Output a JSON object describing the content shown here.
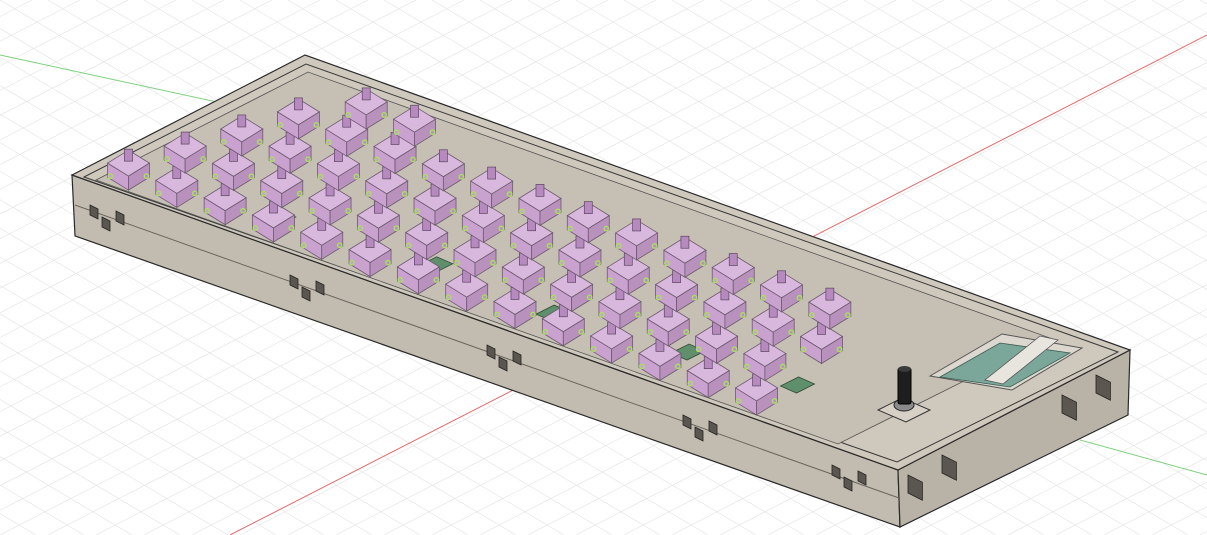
{
  "scene": {
    "subject": "mechanical-keyboard-cad-model",
    "background_color": "#ffffff",
    "grid_color": "#e2e2e2",
    "x_axis_color": "#e46a6a",
    "y_axis_color": "#7fd07f",
    "case_color": "#cfc8bc",
    "case_side_color": "#c2bbaf",
    "case_edge_color": "#2a2a2a",
    "plate_color": "#bdb6aa",
    "switch_color": "#caa2cf",
    "switch_top_color": "#d9b8dd",
    "switch_stem_color": "#b78abf",
    "pcb_color": "#5f8f6b",
    "highlight_color": "#a8e060",
    "display_color": "#7aa79a",
    "knob_color": "#1e1e1e",
    "icons": [
      "rotary-encoder-knob-icon",
      "oled-display-icon",
      "case-vent-icon"
    ]
  }
}
